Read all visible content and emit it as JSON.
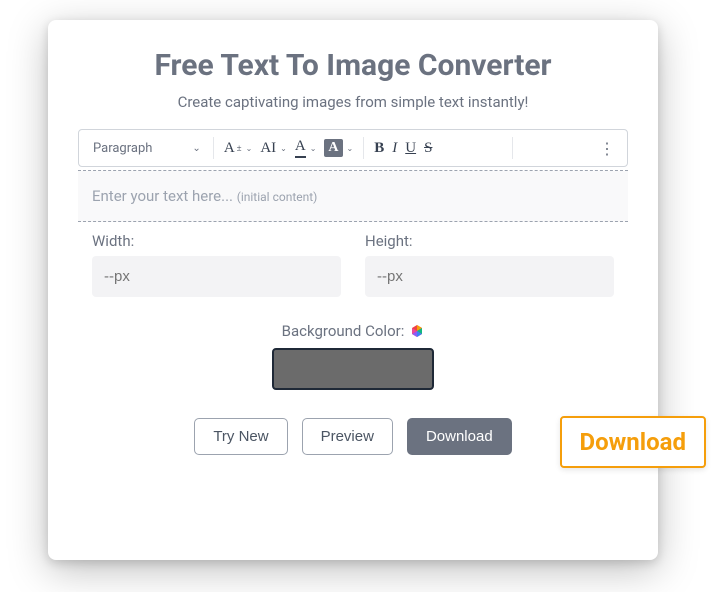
{
  "header": {
    "title": "Free Text To Image Converter",
    "subtitle": "Create captivating images from simple text instantly!"
  },
  "toolbar": {
    "paragraph": "Paragraph",
    "font_size_glyph": "A",
    "font_family_glyph": "AI",
    "color_glyph": "A",
    "highlight_glyph": "A",
    "bold": "B",
    "italic": "I",
    "underline": "U",
    "strike": "S",
    "more": "⋮"
  },
  "editor": {
    "placeholder": "Enter your text here...",
    "initial_note": "(initial content)"
  },
  "dimensions": {
    "width_label": "Width:",
    "width_placeholder": "--px",
    "height_label": "Height:",
    "height_placeholder": "--px"
  },
  "background": {
    "label": "Background Color:",
    "value": "#6b6b6b"
  },
  "actions": {
    "try_new": "Try New",
    "preview": "Preview",
    "download": "Download"
  },
  "callout": {
    "label": "Download"
  }
}
